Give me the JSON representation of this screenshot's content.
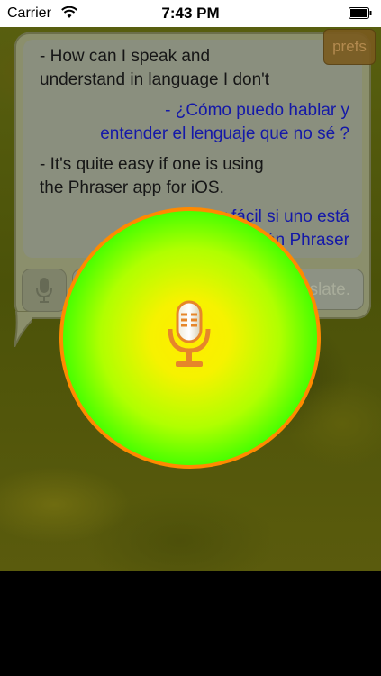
{
  "status_bar": {
    "carrier": "Carrier",
    "time": "7:43 PM",
    "icons": [
      "wifi-icon",
      "battery-icon"
    ]
  },
  "prefs": {
    "label": "prefs"
  },
  "conversation": [
    {
      "kind": "source",
      "lines": [
        "- How can I speak and",
        "understand in language I don't"
      ]
    },
    {
      "kind": "target",
      "lines": [
        "- ¿Cómo puedo hablar y",
        "entender el lenguaje que no sé ?"
      ]
    },
    {
      "kind": "source",
      "lines": [
        "- It's quite easy if one is using",
        "the Phraser app for iOS."
      ]
    },
    {
      "kind": "target",
      "lines": [
        "- Es muy fácil si uno está",
        "utilizando la aplicación Phraser"
      ]
    }
  ],
  "input": {
    "placeholder": "...translate."
  },
  "record_button": {
    "icon": "microphone-icon"
  },
  "colors": {
    "target_text": "#1418a8",
    "ring": "#ff8a00",
    "center": "#ffec00",
    "edge": "#1cff00"
  }
}
